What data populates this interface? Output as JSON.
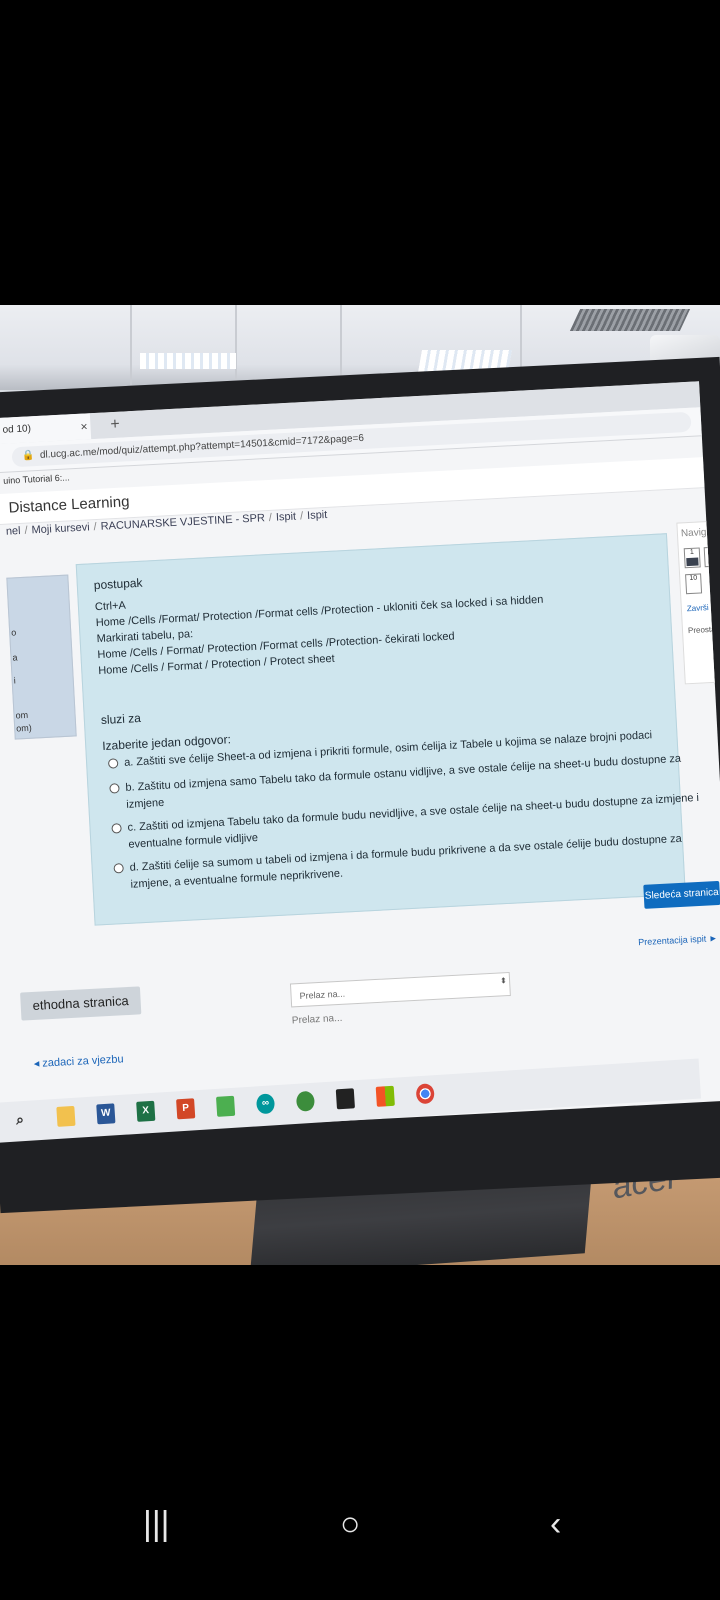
{
  "browser": {
    "tab_title": "od 10)",
    "tab_close": "×",
    "new_tab": "+",
    "lock_icon": "lock-icon",
    "url": "dl.ucg.ac.me/mod/quiz/attempt.php?attempt=14501&cmid=7172&page=6",
    "bookmark": "uino Tutorial 6:..."
  },
  "site": {
    "title": "Distance Learning",
    "breadcrumbs": [
      "nel",
      "Moji kursevi",
      "RACUNARSKE VJESTINE - SPR",
      "Ispit",
      "Ispit"
    ]
  },
  "left_panel": {
    "lines": [
      "o",
      "a",
      "i",
      "om",
      "om)"
    ]
  },
  "question": {
    "heading": "postupak",
    "steps": [
      "Ctrl+A",
      "Home /Cells /Format/ Protection /Format cells /Protection - ukloniti ček sa locked i sa hidden",
      "Markirati tabelu, pa:",
      "Home /Cells / Format/ Protection /Format cells /Protection- čekirati locked",
      "Home /Cells / Format / Protection / Protect sheet"
    ],
    "purpose": "sluzi za",
    "prompt": "Izaberite jedan odgovor:",
    "options": [
      {
        "text": "a.  Zaštiti sve ćelije Sheet-a od izmjena i prikriti formule, osim ćelija iz Tabele  u kojima se nalaze brojni podaci",
        "cont": ""
      },
      {
        "text": "b.  Zaštitu od izmjena samo Tabelu  tako da formule ostanu vidljive, a sve ostale ćelije na sheet-u budu dostupne za",
        "cont": "izmjene"
      },
      {
        "text": "c. Zaštiti od izmjena Tabelu  tako da formule budu nevidljive, a sve ostale ćelije na sheet-u budu dostupne za izmjene i",
        "cont": "eventualne formule vidljive"
      },
      {
        "text": "d. Zaštiti ćelije sa sumom u tabeli od izmjena i da formule budu prikrivene a da sve ostale ćelije budu dostupne za",
        "cont": "izmjene, a eventualne formule neprikrivene."
      }
    ]
  },
  "nav": {
    "title": "Navigacija",
    "boxes": [
      "1",
      "2",
      "10"
    ],
    "finish": "Završi po",
    "remaining": "Preosta"
  },
  "buttons": {
    "next": "Sledeća stranica",
    "prev": "ethodna stranica",
    "presentation": "Prezentacija ispit ►"
  },
  "jump": {
    "placeholder": "Prelaz na...",
    "label": "Prelaz na..."
  },
  "exercise_link": "◂ zadaci za vjezbu",
  "monitor_brand": "acer",
  "stand_brand": "acer",
  "taskbar_icons": [
    "search-icon",
    "file-explorer-icon",
    "word-icon",
    "excel-icon",
    "powerpoint-icon",
    "sheets-icon",
    "arduino-icon",
    "app-icon",
    "terminal-icon",
    "winapp-icon",
    "chrome-icon"
  ],
  "android_nav": {
    "recents": "|||",
    "home": "○",
    "back": "‹"
  }
}
